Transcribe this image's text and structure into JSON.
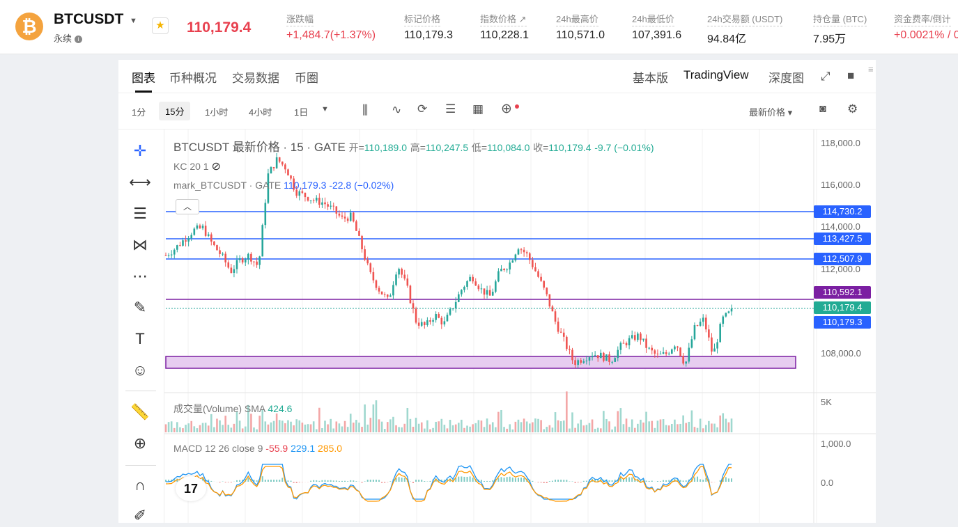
{
  "header": {
    "coin_symbol": "₿",
    "pair": "BTCUSDT",
    "type": "永续",
    "last_price": "110,179.4",
    "stats": [
      {
        "label": "涨跌幅",
        "value": "+1,484.7(+1.37%)",
        "color": "red"
      },
      {
        "label": "标记价格",
        "value": "110,179.3"
      },
      {
        "label": "指数价格 ↗",
        "value": "110,228.1"
      },
      {
        "label": "24h最高价",
        "value": "110,571.0"
      },
      {
        "label": "24h最低价",
        "value": "107,391.6"
      },
      {
        "label": "24h交易额 (USDT)",
        "value": "94.84亿"
      },
      {
        "label": "持仓量 (BTC)",
        "value": "7.95万"
      },
      {
        "label": "资金费率/倒计",
        "value": "+0.0021% / 0",
        "color": "red"
      }
    ]
  },
  "tabs": {
    "chart": "图表",
    "overview": "币种概况",
    "trading_data": "交易数据",
    "circle": "币圈"
  },
  "views": {
    "basic": "基本版",
    "tradingview": "TradingView",
    "depth": "深度图"
  },
  "timeframes": [
    "1分",
    "15分",
    "1小时",
    "4小时",
    "1日"
  ],
  "price_type": "最新价格 ▾",
  "legend": {
    "title": "BTCUSDT 最新价格 · 15 · GATE",
    "open_label": "开=",
    "open": "110,189.0",
    "high_label": "高=",
    "high": "110,247.5",
    "low_label": "低=",
    "low": "110,084.0",
    "close_label": "收=",
    "close": "110,179.4",
    "change": "-9.7 (−0.01%)",
    "kc": "KC 20 1",
    "mark": "mark_BTCUSDT · GATE",
    "mark_price": "110,179.3",
    "mark_change": "-22.8 (−0.02%)",
    "volume": "成交量(Volume) SMA",
    "volume_val": "424.6",
    "macd": "MACD 12 26 close 9",
    "macd_hist": "-55.9",
    "macd_line": "229.1",
    "macd_signal": "285.0"
  },
  "price_axis": [
    "118,000.0",
    "116,000.0",
    "114,000.0",
    "112,000.0",
    "108,000.0"
  ],
  "vol_axis": "5K",
  "macd_axis": [
    "1,000.0",
    "0.0"
  ],
  "levels": [
    "114,730.2",
    "113,427.5",
    "112,507.9",
    "110,592.1",
    "110,179.4",
    "110,179.3"
  ],
  "colors": {
    "up": "#26a69a",
    "down": "#ef5350",
    "level": "#2962ff",
    "purple": "#7b1fa2",
    "zone": "#e7cdf0",
    "green": "#22ab94",
    "red": "#e8414f"
  },
  "chart_data": {
    "type": "line",
    "series": [
      {
        "values": [
          113000,
          113300,
          113700,
          114100,
          114200,
          113500,
          113000,
          112300,
          112800,
          113000,
          112500,
          116500,
          117200,
          116800,
          115800,
          115600,
          115400,
          115300,
          115000,
          114600,
          114700,
          113500,
          112200,
          111500,
          111000,
          112600,
          111600,
          110100,
          109900,
          110400,
          110000,
          110800,
          111600,
          112100,
          111500,
          111200,
          112300,
          112600,
          113400,
          113000,
          112200,
          111300,
          110100,
          109200,
          108300,
          108500,
          108700,
          108600,
          108400,
          109000,
          109300,
          109500,
          108900,
          108600,
          108700,
          109200,
          108200,
          109800,
          110200,
          108600,
          110200,
          110550
        ]
      }
    ],
    "ylim": [
      107000,
      118500
    ]
  }
}
